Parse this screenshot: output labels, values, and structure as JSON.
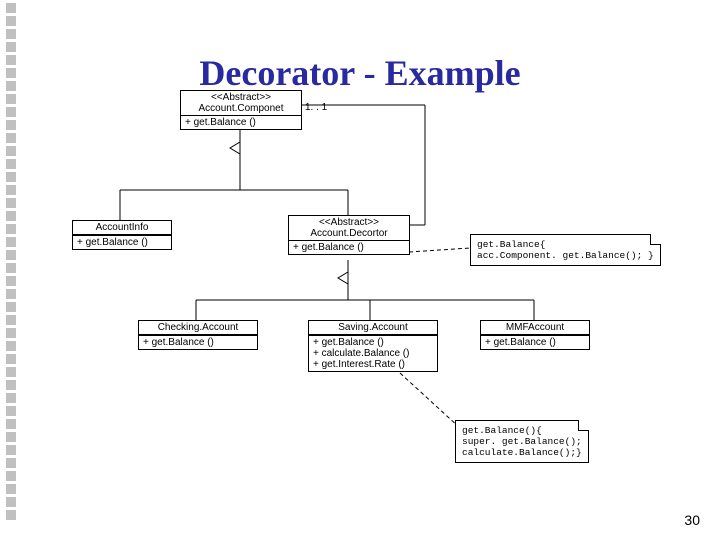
{
  "title": "Decorator - Example",
  "page_number": "30",
  "multiplicity": "1. . 1",
  "classes": {
    "component": {
      "stereo": "<<Abstract>>",
      "name": "Account.Componet",
      "ops": [
        "+ get.Balance ()"
      ]
    },
    "info": {
      "name": "AccountInfo",
      "ops": [
        "+ get.Balance  ()"
      ]
    },
    "decor": {
      "stereo": "<<Abstract>>",
      "name": "Account.Decortor",
      "ops": [
        "+ get.Balance ()"
      ]
    },
    "checking": {
      "name": "Checking.Account",
      "ops": [
        "+ get.Balance ()"
      ]
    },
    "saving": {
      "name": "Saving.Account",
      "ops": [
        "+ get.Balance ()",
        "+ calculate.Balance ()",
        "+ get.Interest.Rate ()"
      ]
    },
    "mmf": {
      "name": "MMFAccount",
      "ops": [
        "+ get.Balance ()"
      ]
    }
  },
  "notes": {
    "decor_note": "get.Balance{\n acc.Component. get.Balance(); }",
    "saving_note": "get.Balance(){\n  super. get.Balance();\n  calculate.Balance();}"
  }
}
